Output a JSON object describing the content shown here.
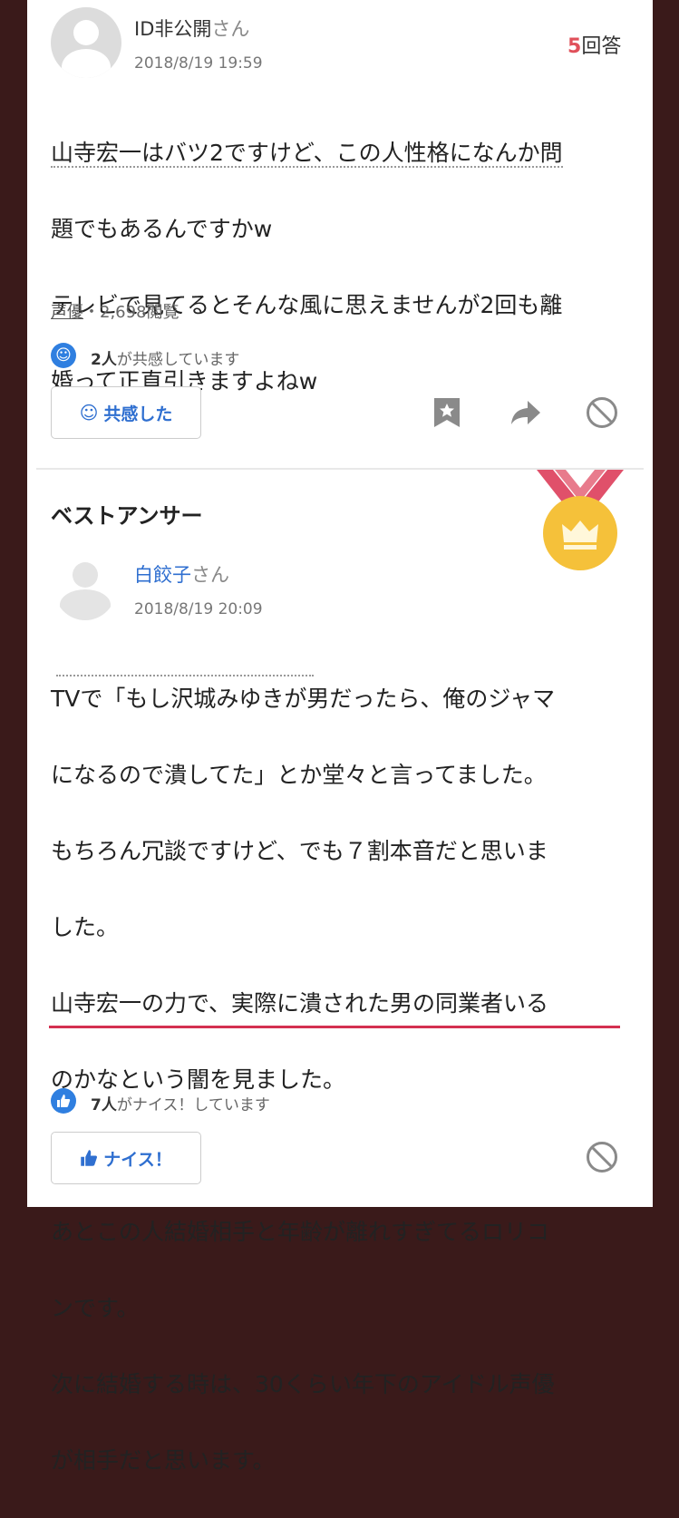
{
  "question": {
    "user_name": "ID非公開",
    "user_suffix": "さん",
    "date": "2018/8/19 19:59",
    "answer_count": "5",
    "answer_label": "回答",
    "text_lines": [
      "山寺宏一はバツ2ですけど、この人性格になんか問",
      "題でもあるんですかw",
      "テレビで見てるとそんな風に思えませんが2回も離",
      "婚って正直引きますよねw"
    ],
    "category": "声優",
    "views": "・2,698閲覧",
    "empathy_count": "2人",
    "empathy_text": "が共感しています",
    "empathy_button": "共感した"
  },
  "best_answer": {
    "title": "ベストアンサー",
    "user_name": "白餃子",
    "user_suffix": "さん",
    "date": "2018/8/19 20:09",
    "text_lines": [
      "TVで「もし沢城みゆきが男だったら、俺のジャマ",
      "になるので潰してた」とか堂々と言ってました。",
      "もちろん冗談ですけど、でも７割本音だと思いま",
      "した。",
      "山寺宏一の力で、実際に潰された男の同業者いる",
      "のかなという闇を見ました。",
      "",
      "あとこの人結婚相手と年齢が離れすぎてるロリコ",
      "ンです。",
      "次に結婚する時は、30くらい年下のアイドル声優",
      "が相手だと思います。"
    ],
    "nice_count": "7人",
    "nice_text": "がナイス！しています",
    "nice_button": "ナイス！"
  },
  "icons": {
    "bookmark": "bookmark-icon",
    "share": "share-arrow-icon",
    "block": "block-icon",
    "smile": "smile-icon",
    "thumbs_up": "thumbs-up-icon",
    "medal": "gold-medal-icon"
  },
  "colors": {
    "accent_blue": "#2f7fe0",
    "answer_count_red": "#e0505a",
    "medal_gold": "#f5c13a",
    "ribbon_red": "#e0506a",
    "underline_red": "#d43050"
  }
}
